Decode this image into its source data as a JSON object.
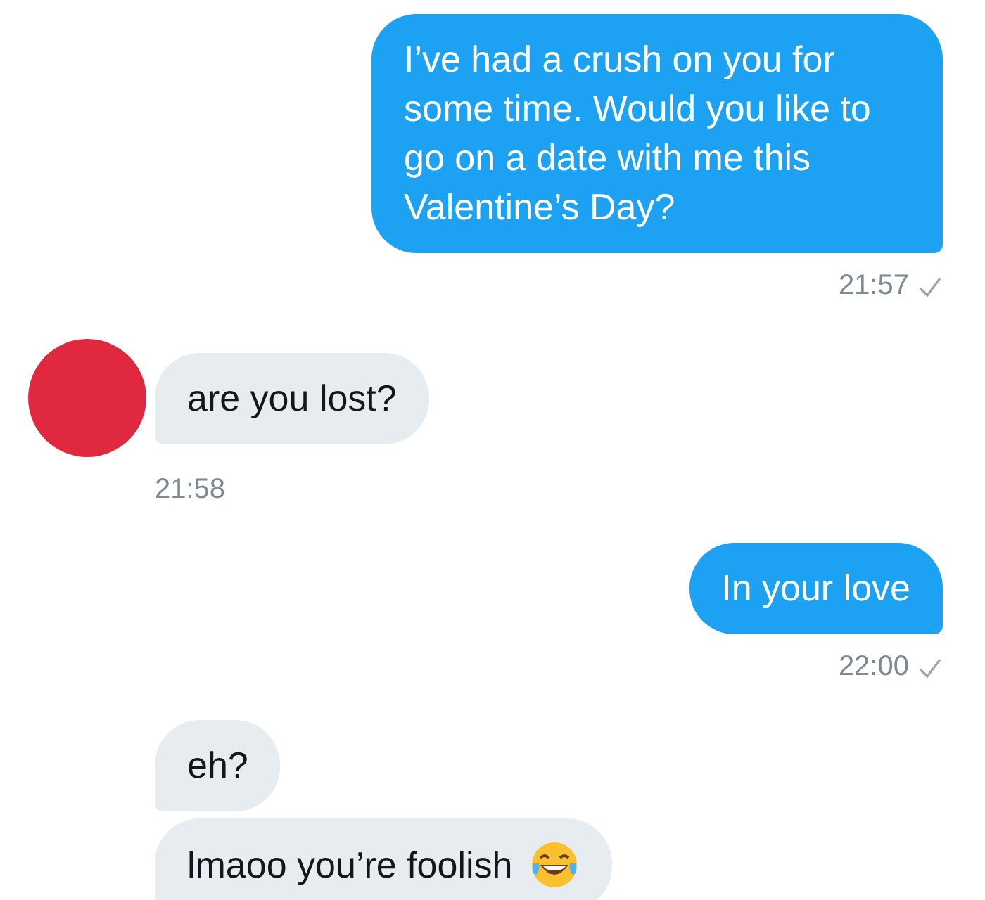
{
  "messages": [
    {
      "kind": "sent",
      "text": "I’ve had a crush on you for some time. Would you like to go on a date with me this Valentine’s Day?",
      "time": "21:57",
      "delivered": true
    },
    {
      "kind": "received",
      "text": "are you lost?",
      "avatar": true,
      "time": "21:58"
    },
    {
      "kind": "sent",
      "text": "In your love",
      "time": "22:00",
      "delivered": true
    },
    {
      "kind": "received",
      "text": "eh?"
    },
    {
      "kind": "received",
      "text": "lmaoo you’re foolish",
      "emoji": true
    }
  ]
}
